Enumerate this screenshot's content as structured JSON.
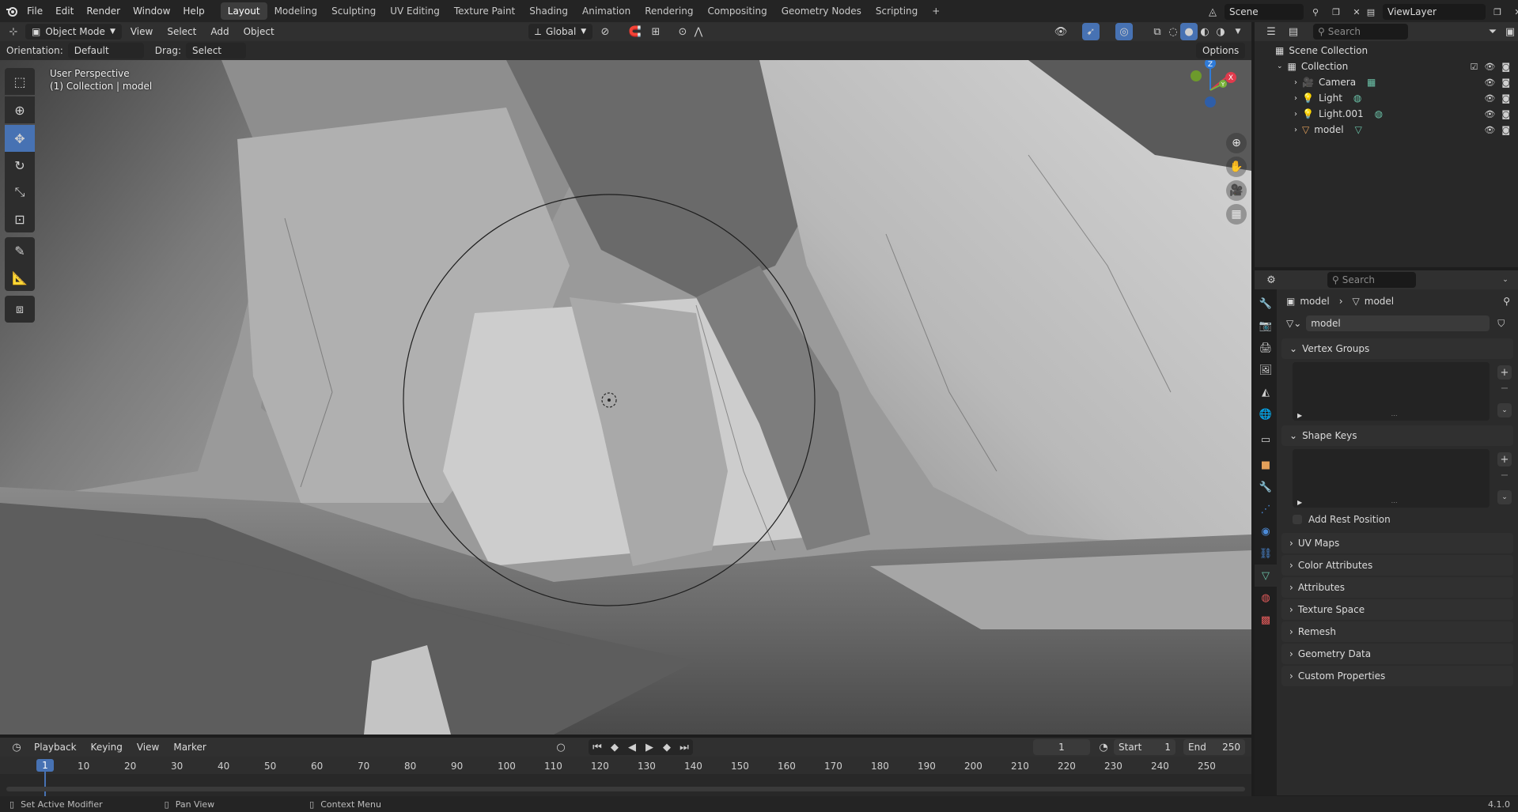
{
  "topbar": {
    "menus": [
      "File",
      "Edit",
      "Render",
      "Window",
      "Help"
    ],
    "workspaces": [
      "Layout",
      "Modeling",
      "Sculpting",
      "UV Editing",
      "Texture Paint",
      "Shading",
      "Animation",
      "Rendering",
      "Compositing",
      "Geometry Nodes",
      "Scripting"
    ],
    "active_workspace": "Layout",
    "add_tab": "+",
    "scene": "Scene",
    "view_layer": "ViewLayer"
  },
  "viewport_header": {
    "mode": "Object Mode",
    "menus": [
      "View",
      "Select",
      "Add",
      "Object"
    ],
    "transform_orientation": "Global",
    "orientation_label": "Orientation:",
    "orientation_value": "Default",
    "drag_label": "Drag:",
    "drag_value": "Select Box",
    "options": "Options"
  },
  "viewport": {
    "perspective": "User Perspective",
    "collection_info": "(1) Collection | model",
    "gizmo_axes": {
      "z": "Z",
      "x": "X",
      "y": "Y"
    }
  },
  "outliner": {
    "search_placeholder": "Search",
    "root": "Scene Collection",
    "collection": "Collection",
    "items": [
      {
        "name": "Camera"
      },
      {
        "name": "Light"
      },
      {
        "name": "Light.001"
      },
      {
        "name": "model"
      }
    ]
  },
  "properties": {
    "search_placeholder": "Search",
    "breadcrumb_object": "model",
    "breadcrumb_data": "model",
    "datablock": "model",
    "panels": {
      "vertex_groups": "Vertex Groups",
      "shape_keys": "Shape Keys",
      "add_rest_position": "Add Rest Position",
      "collapsed": [
        "UV Maps",
        "Color Attributes",
        "Attributes",
        "Texture Space",
        "Remesh",
        "Geometry Data",
        "Custom Properties"
      ]
    }
  },
  "timeline": {
    "menus": [
      "Playback",
      "Keying",
      "View",
      "Marker"
    ],
    "current_frame": "1",
    "start_label": "Start",
    "start": "1",
    "end_label": "End",
    "end": "250",
    "frame_marker": "1",
    "ticks": [
      "10",
      "20",
      "30",
      "40",
      "50",
      "60",
      "70",
      "80",
      "90",
      "100",
      "110",
      "120",
      "130",
      "140",
      "150",
      "160",
      "170",
      "180",
      "190",
      "200",
      "210",
      "220",
      "230",
      "240",
      "250"
    ]
  },
  "statusbar": {
    "left": "Set Active Modifier",
    "middle": "Pan View",
    "right": "Context Menu",
    "version": "4.1.0"
  }
}
